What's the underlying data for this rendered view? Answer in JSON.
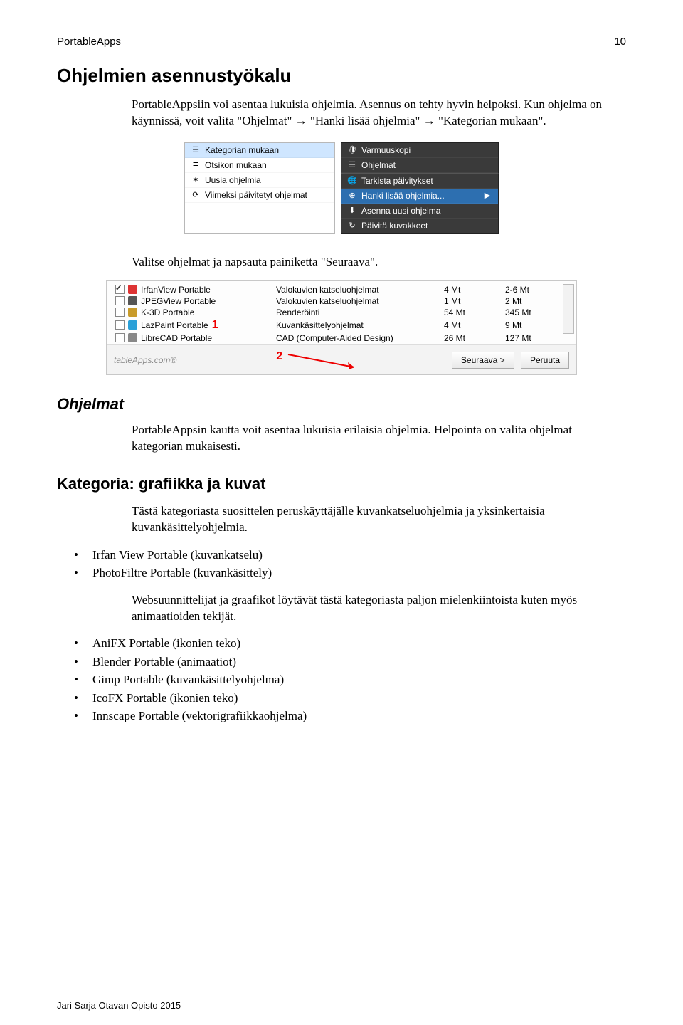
{
  "header": {
    "left": "PortableApps",
    "page": "10"
  },
  "sections": {
    "title": "Ohjelmien asennustyökalu",
    "intro": "PortableAppsiin voi asentaa lukuisia ohjelmia. Asennus on tehty hyvin helpoksi. Kun ohjelma on käynnissä, voit valita \"Ohjelmat\" → \"Hanki lisää ohjelmia\" → \"Kategorian mukaan\".",
    "step2": "Valitse ohjelmat ja napsauta painiketta \"Seuraava\".",
    "ohjelmat_title": "Ohjelmat",
    "ohjelmat_body": "PortableAppsin kautta voit asentaa lukuisia erilaisia ohjelmia. Helpointa on valita ohjelmat kategorian mukaisesti.",
    "kategoria_title": "Kategoria: grafiikka ja kuvat",
    "kategoria_body1": "Tästä kategoriasta suosittelen peruskäyttäjälle kuvankatseluohjelmia ja yksinkertaisia kuvankäsittelyohjelmia.",
    "kategoria_list1": [
      "Irfan View Portable (kuvankatselu)",
      "PhotoFiltre Portable (kuvankäsittely)"
    ],
    "kategoria_body2": "Websuunnittelijat ja graafikot löytävät tästä kategoriasta paljon mielenkiintoista kuten myös animaatioiden tekijät.",
    "kategoria_list2": [
      "AniFX Portable (ikonien teko)",
      "Blender Portable (animaatiot)",
      "Gimp Portable (kuvankäsittelyohjelma)",
      "IcoFX Portable (ikonien teko)",
      "Innscape Portable (vektorigrafiikkaohjelma)"
    ]
  },
  "shot1": {
    "left_items": [
      {
        "icon": "☰",
        "label": "Kategorian mukaan",
        "selected": true
      },
      {
        "icon": "≣",
        "label": "Otsikon mukaan"
      },
      {
        "icon": "✶",
        "label": "Uusia ohjelmia"
      },
      {
        "icon": "⟳",
        "label": "Viimeksi päivitetyt ohjelmat"
      }
    ],
    "right_top": [
      {
        "icon": "🛡",
        "label": "Varmuuskopi"
      },
      {
        "icon": "☰",
        "label": "Ohjelmat"
      }
    ],
    "right_items": [
      {
        "icon": "🌐",
        "label": "Tarkista päivitykset"
      },
      {
        "icon": "⊕",
        "label": "Hanki lisää ohjelmia...",
        "selected": true,
        "chevron": "▶"
      },
      {
        "icon": "⬇",
        "label": "Asenna uusi ohjelma"
      },
      {
        "icon": "↻",
        "label": "Päivitä kuvakkeet"
      }
    ]
  },
  "shot2": {
    "rows": [
      {
        "checked": true,
        "color": "#d33",
        "name": "IrfanView Portable",
        "cat": "Valokuvien katseluohjelmat",
        "c1": "4 Mt",
        "c2": "2-6 Mt"
      },
      {
        "checked": false,
        "color": "#555",
        "name": "JPEGView Portable",
        "cat": "Valokuvien katseluohjelmat",
        "c1": "1 Mt",
        "c2": "2 Mt"
      },
      {
        "checked": false,
        "color": "#c89b2a",
        "name": "K-3D Portable",
        "cat": "Renderöinti",
        "c1": "54 Mt",
        "c2": "345 Mt"
      },
      {
        "checked": false,
        "color": "#2aa0d8",
        "name": "LazPaint Portable",
        "cat": "Kuvankäsittelyohjelmat",
        "c1": "4 Mt",
        "c2": "9 Mt",
        "num": "1"
      },
      {
        "checked": false,
        "color": "#888",
        "name": "LibreCAD Portable",
        "cat": "CAD (Computer-Aided Design)",
        "c1": "26 Mt",
        "c2": "127 Mt"
      }
    ],
    "watermark": "tableApps.com®",
    "num2": "2",
    "btn_next": "Seuraava >",
    "btn_cancel": "Peruuta"
  },
  "footer_credit": "Jari Sarja Otavan Opisto 2015"
}
